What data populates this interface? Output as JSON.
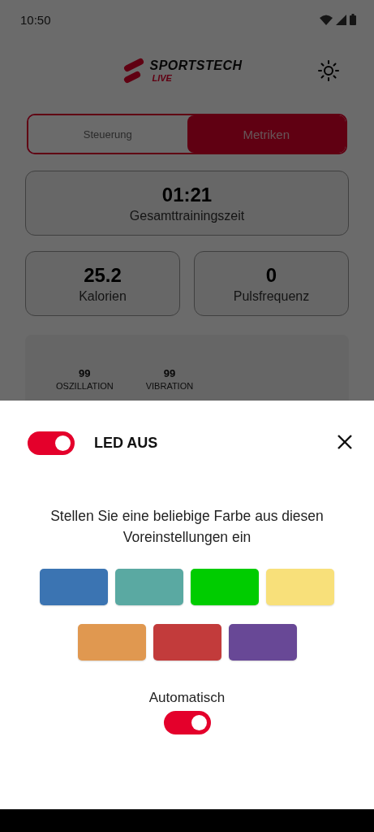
{
  "status_bar": {
    "time": "10:50"
  },
  "header": {
    "logo_title": "SPORTSTECH",
    "logo_subtitle": "LIVE"
  },
  "tabs": [
    {
      "label": "Steuerung",
      "selected": false
    },
    {
      "label": "Metriken",
      "selected": true
    }
  ],
  "metrics": [
    {
      "value": "01:21",
      "label": "Gesamttrainingszeit"
    },
    {
      "value": "25.2",
      "label": "Kalorien"
    },
    {
      "value": "0",
      "label": "Pulsfrequenz"
    }
  ],
  "panel": {
    "stats": [
      {
        "value": "99",
        "label": "OSZILLATION"
      },
      {
        "value": "99",
        "label": "VIBRATION"
      }
    ]
  },
  "led_sheet": {
    "toggle_on": true,
    "title": "LED AUS",
    "instruction": "Stellen Sie eine beliebige Farbe aus diesen Voreinstellungen ein",
    "presets": [
      {
        "color": "#3b74b2"
      },
      {
        "color": "#5aa9a2"
      },
      {
        "color": "#00cc00"
      },
      {
        "color": "#f8e07a"
      },
      {
        "color": "#e09850"
      },
      {
        "color": "#c23b3b"
      },
      {
        "color": "#684896"
      }
    ],
    "auto": {
      "label": "Automatisch",
      "on": true
    }
  }
}
